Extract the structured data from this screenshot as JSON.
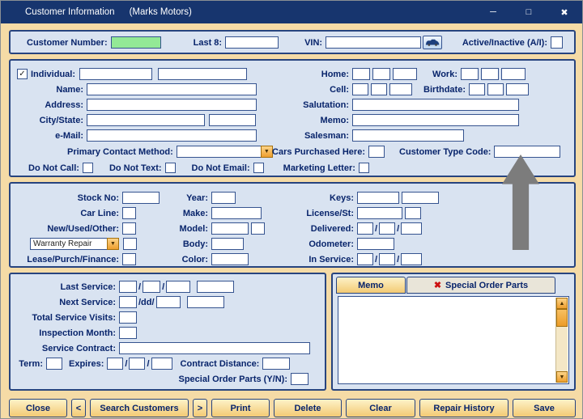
{
  "titlebar": {
    "title": "Customer Information",
    "subtitle": "(Marks Motors)"
  },
  "glyphs": {
    "check": "✓",
    "slash": "/",
    "dropdown_arrow": "▼",
    "scroll_up": "▲",
    "scroll_down": "▼",
    "red_x": "✖",
    "minimize": "─",
    "maximize": "□",
    "close": "✖"
  },
  "header": {
    "customer_number": "Customer Number:",
    "last8": "Last 8:",
    "vin": "VIN:",
    "active_inactive": "Active/Inactive (A/I):"
  },
  "customer": {
    "individual": "Individual:",
    "name": "Name:",
    "address": "Address:",
    "city_state": "City/State:",
    "email": "e-Mail:",
    "primary_contact": "Primary Contact Method:",
    "home": "Home:",
    "work": "Work:",
    "cell": "Cell:",
    "birthdate": "Birthdate:",
    "salutation": "Salutation:",
    "memo": "Memo:",
    "salesman": "Salesman:",
    "cars_purchased": "Cars Purchased Here:",
    "customer_type": "Customer Type Code:",
    "do_not_call": "Do Not Call:",
    "do_not_text": "Do Not Text:",
    "do_not_email": "Do Not Email:",
    "marketing_letter": "Marketing Letter:"
  },
  "vehicle": {
    "stock_no": "Stock No:",
    "car_line": "Car Line:",
    "new_used_other": "New/Used/Other:",
    "warranty_repair": "Warranty Repair",
    "lease_purch_finance": "Lease/Purch/Finance:",
    "year": "Year:",
    "make": "Make:",
    "model": "Model:",
    "body": "Body:",
    "color": "Color:",
    "keys": "Keys:",
    "license_st": "License/St:",
    "delivered": "Delivered:",
    "odometer": "Odometer:",
    "in_service": "In Service:"
  },
  "service": {
    "last_service": "Last Service:",
    "next_service": "Next Service:",
    "dd_separator": "/dd/",
    "total_visits": "Total Service Visits:",
    "inspection_month": "Inspection Month:",
    "service_contract": "Service Contract:",
    "term": "Term:",
    "expires": "Expires:",
    "contract_distance": "Contract Distance:",
    "special_order_parts": "Special Order Parts (Y/N):"
  },
  "memo_panel": {
    "tab_memo": "Memo",
    "tab_special_order": "Special Order Parts"
  },
  "footer": {
    "close": "Close",
    "prev": "<",
    "search": "Search Customers",
    "next": ">",
    "print": "Print",
    "delete": "Delete",
    "clear": "Clear",
    "repair_history": "Repair History",
    "save": "Save"
  },
  "colors": {
    "titlebar": "#17356e",
    "background": "#f5dba6",
    "panel": "#d9e3f1",
    "border": "#27447f",
    "customer_number_bg": "#93e996",
    "accent_orange": "#ee9f2e",
    "annotation_gray": "#7c7c7c"
  }
}
